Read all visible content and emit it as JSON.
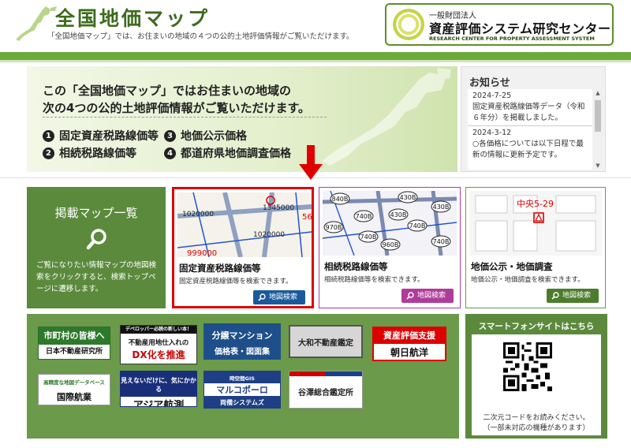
{
  "header": {
    "title": "全国地価マップ",
    "subtitle": "「全国地価マップ」では、お住まいの地域の４つの公的土地評価情報がご覧いただけます。",
    "org_small": "一般財団法人",
    "org_name": "資産評価システム研究センター",
    "org_en": "RESEARCH CENTER FOR PROPERTY ASSESSMENT SYSTEM"
  },
  "hero": {
    "line1": "この「全国地価マップ」ではお住まいの地域の",
    "line2": "次の4つの公的土地評価情報がご覧いただけます。",
    "items": [
      {
        "num": "1",
        "label": "固定資産税路線価等"
      },
      {
        "num": "2",
        "label": "相続税路線価等"
      },
      {
        "num": "3",
        "label": "地価公示価格"
      },
      {
        "num": "4",
        "label": "都道府県地価調査価格"
      }
    ]
  },
  "news": {
    "title": "お知らせ",
    "entries": [
      {
        "date": "2024-7-25",
        "text": "固定資産税路線価等データ（令和６年分）を掲載しました。"
      },
      {
        "date": "2024-3-12",
        "text": "○各価格については以下日程で最新の情報に更新予定です。"
      }
    ]
  },
  "list_card": {
    "title": "掲載マップ一覧",
    "desc": "ご覧になりたい情報マップの地図検索をクリックすると、検索トップページに遷移します。"
  },
  "cards": [
    {
      "title": "固定資産税路線価等",
      "desc": "固定資産税路線価等を検索できます。",
      "button": "地図検索",
      "map_labels": [
        "999000",
        "1020000",
        "1020000",
        "1345000",
        "56"
      ]
    },
    {
      "title": "相続税路線価等",
      "desc": "相続税路線価等を検索できます。",
      "button": "地図検索",
      "map_labels": [
        "840B",
        "430B",
        "740B",
        "970B",
        "740B",
        "960B",
        "430B",
        "740B",
        "430B",
        "740B"
      ]
    },
    {
      "title": "地価公示・地価調査",
      "desc": "地価公示・地価調査を検索できます。",
      "button": "地図検索",
      "map_labels": [
        "中央5-29"
      ]
    }
  ],
  "banners": [
    {
      "id": "municipality",
      "line1": "市町村の皆様へ",
      "line2": "日本不動産研究所"
    },
    {
      "id": "dx",
      "top": "デベロッパー必読の新しい本！",
      "line1": "不動産用地仕入れの",
      "line2": "DX化を推進"
    },
    {
      "id": "mansion",
      "line1": "分譲マンション",
      "line2": "価格表・図面集"
    },
    {
      "id": "yamato",
      "line1": "大和不動産鑑定"
    },
    {
      "id": "asahi",
      "line1": "資産評価支援",
      "line2": "朝日航洋"
    },
    {
      "id": "kokusai",
      "top": "高精度な地図データベース",
      "line1": "国際航業"
    },
    {
      "id": "asia",
      "line1": "見えないだけに、気にかかる",
      "line2": "アジア航測"
    },
    {
      "id": "marco",
      "top": "時空間GIS",
      "line1": "マルコポーロ",
      "line2": "両備システムズ"
    },
    {
      "id": "yazawa",
      "line1": "谷澤総合鑑定所"
    }
  ],
  "smart": {
    "title": "スマートフォンサイトはこちら",
    "note1": "二次元コードをお読みください。",
    "note2": "（一部未対応の機種があります）"
  },
  "colors": {
    "brand_green": "#5c8a3d",
    "highlight_red": "#e00000",
    "btn_blue": "#1a5a9c",
    "btn_pink": "#b03c9a",
    "btn_green": "#4c7d2c"
  }
}
